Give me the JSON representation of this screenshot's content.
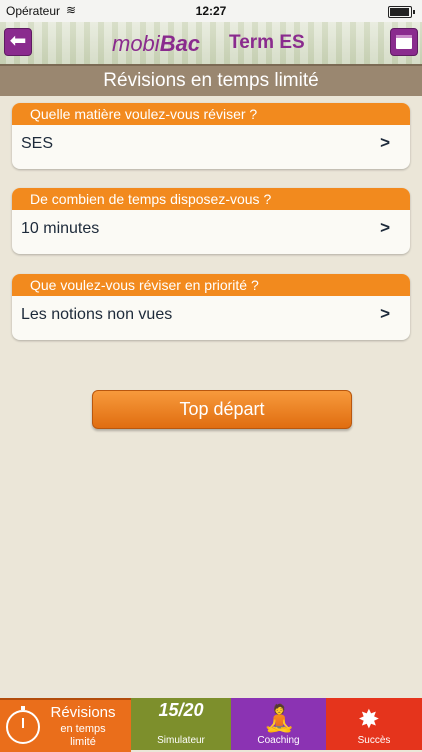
{
  "status": {
    "carrier": "Opérateur",
    "time": "12:27"
  },
  "header": {
    "logo_mobi": "mobi",
    "logo_bac": "Bac",
    "level": "Term ES"
  },
  "title": "Révisions en temps limité",
  "cards": [
    {
      "question": "Quelle matière voulez-vous réviser ?",
      "value": "SES",
      "chevron": ">"
    },
    {
      "question": "De combien de temps disposez-vous ?",
      "value": "10 minutes",
      "chevron": ">"
    },
    {
      "question": "Que voulez-vous réviser en priorité ?",
      "value": "Les notions non vues",
      "chevron": ">"
    }
  ],
  "start_button": "Top départ",
  "tabs": {
    "revisions_main": "Révisions",
    "revisions_sub1": "en temps",
    "revisions_sub2": "limité",
    "simulateur_icon": "15/20",
    "simulateur": "Simulateur",
    "coaching": "Coaching",
    "succes": "Succès"
  },
  "colors": {
    "accent": "#f28a1e",
    "brand": "#8a2b8e",
    "title_bar": "#9a8770"
  }
}
